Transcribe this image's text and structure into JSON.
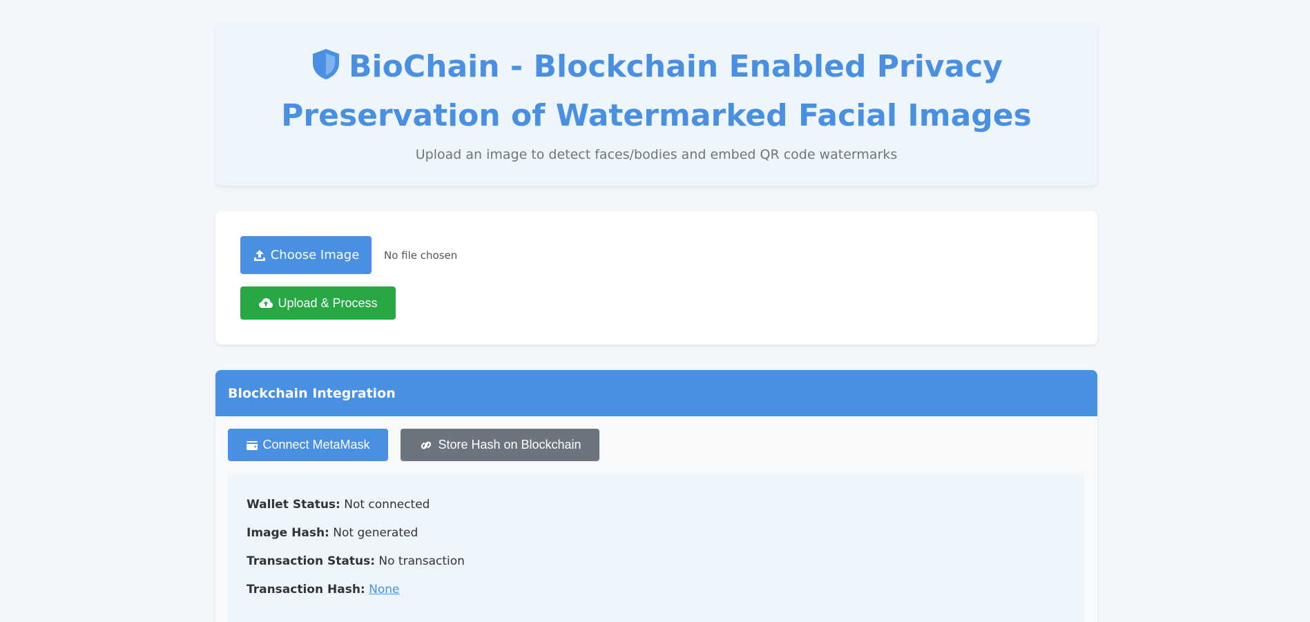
{
  "header": {
    "title": "BioChain - Blockchain Enabled Privacy Preservation of Watermarked Facial Images",
    "subtitle": "Upload an image to detect faces/bodies and embed QR code watermarks",
    "icon": "shield-icon"
  },
  "upload": {
    "choose_label": "Choose Image",
    "file_status": "No file chosen",
    "upload_label": "Upload & Process"
  },
  "blockchain": {
    "header": "Blockchain Integration",
    "connect_label": "Connect MetaMask",
    "store_label": "Store Hash on Blockchain",
    "wallet_label": "Wallet Status:",
    "wallet_value": "Not connected",
    "hash_label": "Image Hash:",
    "hash_value": "Not generated",
    "tx_status_label": "Transaction Status:",
    "tx_status_value": "No transaction",
    "tx_hash_label": "Transaction Hash:",
    "tx_hash_value": "None"
  },
  "colors": {
    "accent": "#4a90e2",
    "success": "#28a745",
    "secondary": "#6c757d",
    "background": "#f3f7fb"
  }
}
